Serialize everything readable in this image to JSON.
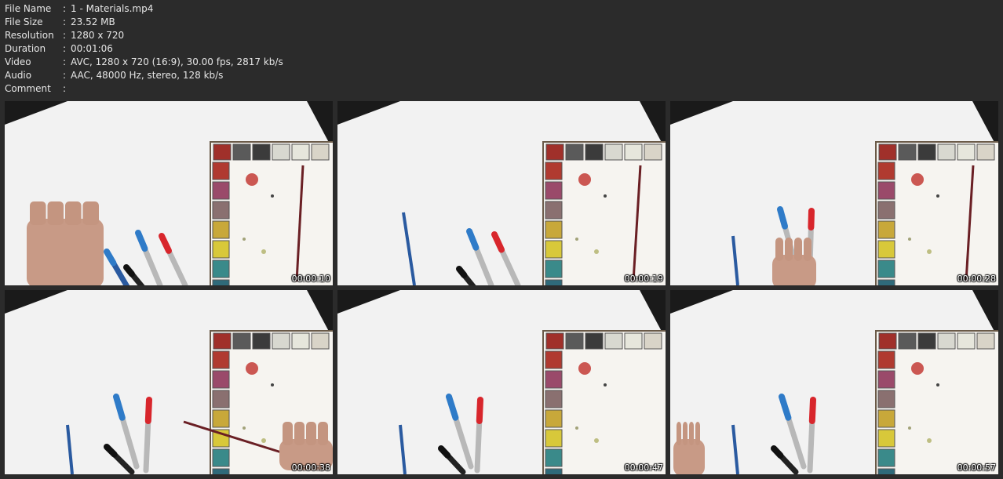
{
  "info": [
    {
      "label": "File Name",
      "value": "1 - Materials.mp4"
    },
    {
      "label": "File Size",
      "value": "23.52 MB"
    },
    {
      "label": "Resolution",
      "value": "1280 x 720"
    },
    {
      "label": "Duration",
      "value": "00:01:06"
    },
    {
      "label": "Video",
      "value": "AVC, 1280 x 720 (16:9), 30.00 fps, 2817 kb/s"
    },
    {
      "label": "Audio",
      "value": "AAC, 48000 Hz, stereo, 128 kb/s"
    },
    {
      "label": "Comment",
      "value": ""
    }
  ],
  "separator": ":",
  "thumbnails": [
    {
      "timestamp": "00:00:10"
    },
    {
      "timestamp": "00:00:19"
    },
    {
      "timestamp": "00:00:28"
    },
    {
      "timestamp": "00:00:38"
    },
    {
      "timestamp": "00:00:47"
    },
    {
      "timestamp": "00:00:57"
    }
  ],
  "colors": {
    "background": "#2b2b2b",
    "text": "#e6e6e6",
    "paper": "#f2f2f2",
    "table": "#1a1a1a",
    "marker_blue": "#2f7bc8",
    "marker_red": "#d8262c",
    "palette_frame": "#8a6a4a"
  }
}
